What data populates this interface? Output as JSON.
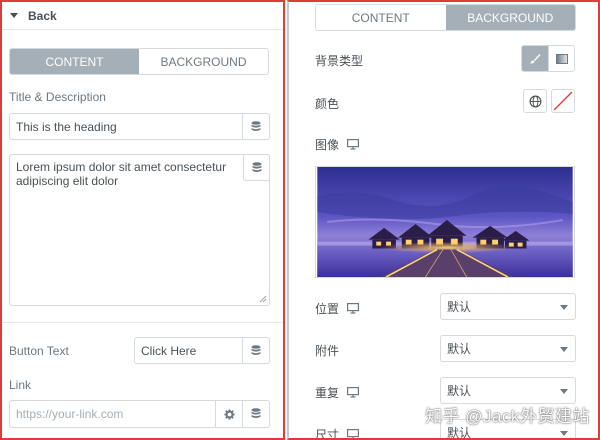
{
  "left": {
    "section_title": "Back",
    "tabs": [
      {
        "label": "CONTENT",
        "active": true
      },
      {
        "label": "BACKGROUND",
        "active": false
      }
    ],
    "title_desc_label": "Title & Description",
    "heading_value": "This is the heading",
    "description_value": "Lorem ipsum dolor sit amet consectetur adipiscing elit dolor",
    "button_text_label": "Button Text",
    "button_text_value": "Click Here",
    "link_label": "Link",
    "link_placeholder": "https://your-link.com"
  },
  "right": {
    "tabs": [
      {
        "label": "CONTENT",
        "active": false
      },
      {
        "label": "BACKGROUND",
        "active": true
      }
    ],
    "bg_type_label": "背景类型",
    "color_label": "颜色",
    "image_label": "图像",
    "position_label": "位置",
    "position_value": "默认",
    "attachment_label": "附件",
    "attachment_value": "默认",
    "repeat_label": "重复",
    "repeat_value": "默认",
    "size_label": "尺寸",
    "size_value": "默认"
  },
  "watermark": "知乎 @Jack外贸建站",
  "colors": {
    "accent": "#a4afb7",
    "border_highlight": "#e03b3b",
    "text": "#495157"
  }
}
